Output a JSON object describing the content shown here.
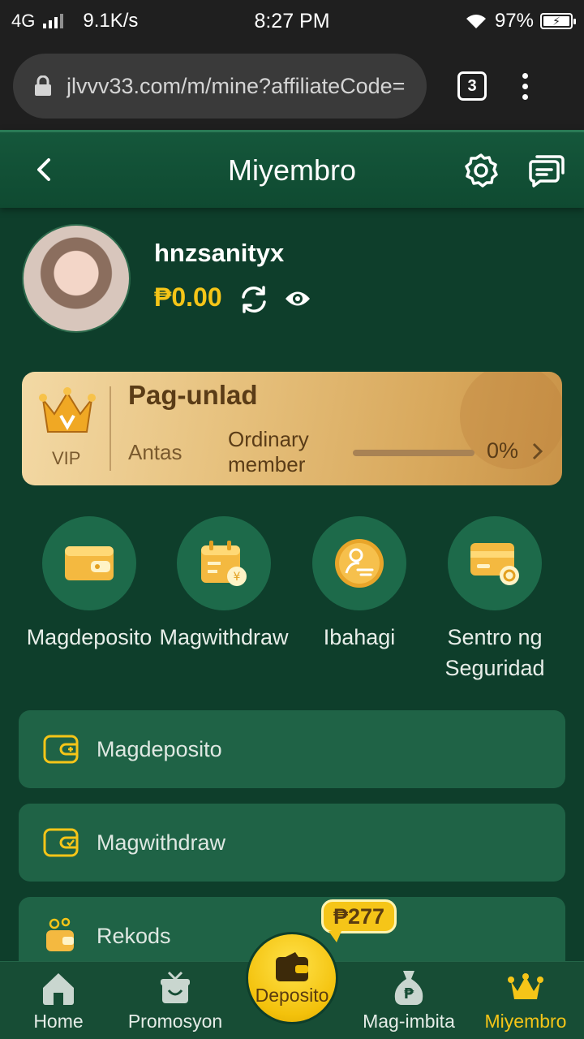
{
  "status_bar": {
    "network": "4G",
    "speed": "9.1K/s",
    "time": "8:27 PM",
    "battery": "97%"
  },
  "browser": {
    "url": "jlvvv33.com/m/mine?affiliateCode=",
    "tab_count": "3"
  },
  "header": {
    "title": "Miyembro"
  },
  "profile": {
    "username": "hnzsanityx",
    "balance": "₱0.00"
  },
  "vip": {
    "badge": "VIP",
    "title": "Pag-unlad",
    "level_label": "Antas",
    "level_value": "Ordinary member",
    "progress_text": "0%",
    "progress_fraction": 0
  },
  "quick_actions": [
    {
      "label": "Magdeposito",
      "icon": "wallet-card-icon"
    },
    {
      "label": "Magwithdraw",
      "icon": "calendar-coin-icon"
    },
    {
      "label": "Ibahagi",
      "icon": "share-people-icon"
    },
    {
      "label": "Sentro ng Seguridad",
      "icon": "secure-card-icon"
    }
  ],
  "menu": [
    {
      "label": "Magdeposito",
      "icon": "wallet-plus-icon"
    },
    {
      "label": "Magwithdraw",
      "icon": "wallet-minus-icon"
    },
    {
      "label": "Rekods",
      "icon": "records-icon"
    }
  ],
  "bottom_nav": {
    "items": [
      {
        "label": "Home",
        "icon": "home-icon"
      },
      {
        "label": "Promosyon",
        "icon": "gift-icon"
      },
      {
        "label": "Deposito",
        "icon": "wallet-icon"
      },
      {
        "label": "Mag-imbita",
        "icon": "money-bag-icon"
      },
      {
        "label": "Miyembro",
        "icon": "crown-icon"
      }
    ],
    "active": "Miyembro",
    "badge": "₱277"
  },
  "colors": {
    "background": "#0e3e2b",
    "accent": "#f5c518",
    "card": "#1f6346"
  }
}
